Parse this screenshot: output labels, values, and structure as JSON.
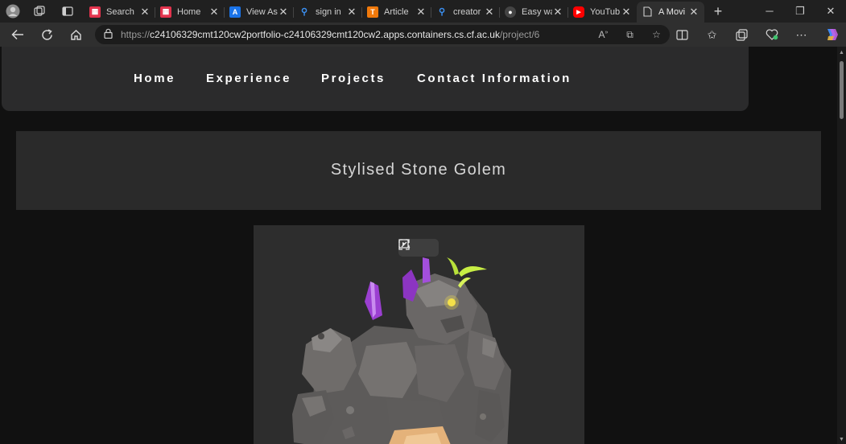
{
  "browser": {
    "tabs": [
      {
        "title": "Search",
        "favicon": "red-grid-icon",
        "color": "#e2334d",
        "close": "✕"
      },
      {
        "title": "Home",
        "favicon": "red-grid-icon",
        "color": "#e2334d",
        "close": "✕"
      },
      {
        "title": "View As",
        "favicon": "blue-a-icon",
        "color": "#1a73e8",
        "close": "✕"
      },
      {
        "title": "sign in",
        "favicon": "search-icon",
        "color": "#3b8ff0",
        "close": "✕"
      },
      {
        "title": "Article",
        "favicon": "orange-t-icon",
        "color": "#f0790b",
        "close": "✕"
      },
      {
        "title": "creator",
        "favicon": "search-icon",
        "color": "#3b8ff0",
        "close": "✕"
      },
      {
        "title": "Easy wa",
        "favicon": "dark-circle-icon",
        "color": "#444444",
        "close": "✕"
      },
      {
        "title": "YouTub",
        "favicon": "youtube-icon",
        "color": "#ff0000",
        "close": "✕"
      },
      {
        "title": "A Movi",
        "favicon": "page-icon",
        "color": "#cfcfcf",
        "close": "✕",
        "active": true
      }
    ],
    "url_protocol": "https://",
    "url_host": "c24106329cmt120cw2portfolio-c24106329cmt120cw2.apps.containers.cs.cf.ac.uk",
    "url_path": "/project/6"
  },
  "site": {
    "nav": [
      "Home",
      "Experience",
      "Projects",
      "Contact Information"
    ],
    "project_title": "Stylised Stone Golem"
  },
  "colors": {
    "page_bg": "#111111",
    "panel_bg": "#2a2a2a",
    "nav_bg": "#2b2b2c",
    "crystal": "#9b3fd1",
    "sprout": "#b8e03a"
  }
}
